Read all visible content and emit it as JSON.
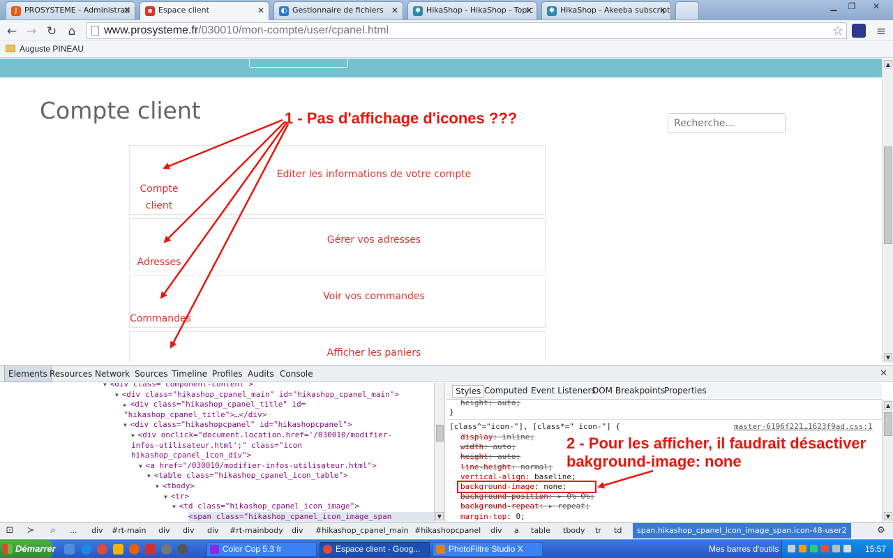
{
  "browser": {
    "tabs": [
      {
        "label": "PROSYSTEME - Administrati",
        "favicon": "joomla-icon",
        "color": "#e45c1a"
      },
      {
        "label": "Espace client",
        "favicon": "page-icon",
        "color": "#d8362d",
        "active": true
      },
      {
        "label": "Gestionnaire de fichiers",
        "favicon": "file-manager-icon",
        "color": "#2a7ad8"
      },
      {
        "label": "HikaShop - HikaShop - Topic",
        "favicon": "hikashop-icon",
        "color": "#2c88b0"
      },
      {
        "label": "HikaShop - Akeeba subscripti",
        "favicon": "hikashop-icon",
        "color": "#2c88b0"
      }
    ],
    "url_host": "www.prosysteme.fr",
    "url_path": "/030010/mon-compte/user/cpanel.html",
    "bookmark": "Auguste PINEAU"
  },
  "page": {
    "title": "Compte client",
    "search_placeholder": "Recherche...",
    "panels": [
      {
        "label_lines": [
          "Compte",
          "client"
        ],
        "description": "Editer les informations de votre compte"
      },
      {
        "label_lines": [
          "Adresses"
        ],
        "description": "Gérer vos adresses"
      },
      {
        "label_lines": [
          "Commandes"
        ],
        "description": "Voir vos commandes"
      },
      {
        "label_lines": [],
        "description": "Afficher les paniers"
      }
    ],
    "annotation1": "1 - Pas d'affichage d'icones ???",
    "annotation2_line1": "2 - Pour les afficher, il faudrait désactiver",
    "annotation2_line2": "bakground-image: none",
    "arrow_color": "#e8160c"
  },
  "devtools": {
    "tabs": [
      "Elements",
      "Resources",
      "Network",
      "Sources",
      "Timeline",
      "Profiles",
      "Audits",
      "Console"
    ],
    "elements": [
      {
        "indent": 0,
        "text": "<div class=\"component-content\">"
      },
      {
        "indent": 1,
        "text": "<div class=\"hikashop_cpanel_main\" id=\"hikashop_cpanel_main\">"
      },
      {
        "indent": 2,
        "text": "<div class=\"hikashop_cpanel_title\" id="
      },
      {
        "indent": 3,
        "text": "\"hikashop_cpanel_title\">…</div>"
      },
      {
        "indent": 2,
        "text": "<div class=\"hikashopcpanel\" id=\"hikashopcpanel\">"
      },
      {
        "indent": 3,
        "text": "<div onclick=\"document.location.href='/030010/modifier-"
      },
      {
        "indent": 4,
        "text": "infos-utilisateur.html';\" class=\"icon"
      },
      {
        "indent": 4,
        "text": "hikashop_cpanel_icon_div\">"
      },
      {
        "indent": 5,
        "text": "<a href=\"/030010/modifier-infos-utilisateur.html\">"
      },
      {
        "indent": 6,
        "text": "<table class=\"hikashop_cpanel_icon_table\">"
      },
      {
        "indent": 7,
        "text": "<tbody>"
      },
      {
        "indent": 8,
        "text": "<tr>"
      },
      {
        "indent": 9,
        "text": "<td class=\"hikashop_cpanel_icon_image\">"
      },
      {
        "indent": 10,
        "text": "<span class=\"hikashop_cpanel_icon_image_span"
      }
    ],
    "style_tabs": [
      "Styles",
      "Computed",
      "Event Listeners",
      "DOM Breakpoints",
      "Properties"
    ],
    "styles": {
      "top_line": "height: auto;",
      "brace": "}",
      "selector": "[class^=\"icon-\"], [class*=\" icon-\"] {",
      "source": "master-6196f221…1623f9ad.css:1",
      "rules": [
        {
          "text": "display: inline;",
          "struck": true
        },
        {
          "text": "width: auto;",
          "struck": true
        },
        {
          "text": "height: auto;",
          "struck": true
        },
        {
          "text": "line-height: normal;",
          "struck": true
        },
        {
          "text": "vertical-align: baseline;",
          "struck": false
        },
        {
          "text": "background-image: none;",
          "struck": false,
          "highlight": true
        },
        {
          "text": "background-position: ▸ 0% 0%;",
          "struck": true
        },
        {
          "text": "background-repeat: ▸ repeat;",
          "struck": true
        },
        {
          "text": "margin-top: 0;",
          "struck": false
        }
      ]
    },
    "breadcrumbs": [
      "...",
      "div",
      "#rt-main",
      "div",
      "div",
      "div",
      "#rt-mainbody",
      "div",
      "#hikashop_cpanel_main",
      "#hikashopcpanel",
      "div",
      "a",
      "table",
      "tbody",
      "tr",
      "td",
      "span.hikashop_cpanel_icon_image_span.icon-48-user2"
    ]
  },
  "taskbar": {
    "start": "Démarrer",
    "windows": [
      {
        "label": "Color Cop 5.3 fr",
        "color": "#8a2be2"
      },
      {
        "label": "Espace client - Goog...",
        "color": "#dd4b39",
        "active": true
      },
      {
        "label": "PhotoFiltre Studio X",
        "color": "#e67e22"
      }
    ],
    "tray_label": "Mes barres d'outils",
    "clock": "15:57"
  }
}
